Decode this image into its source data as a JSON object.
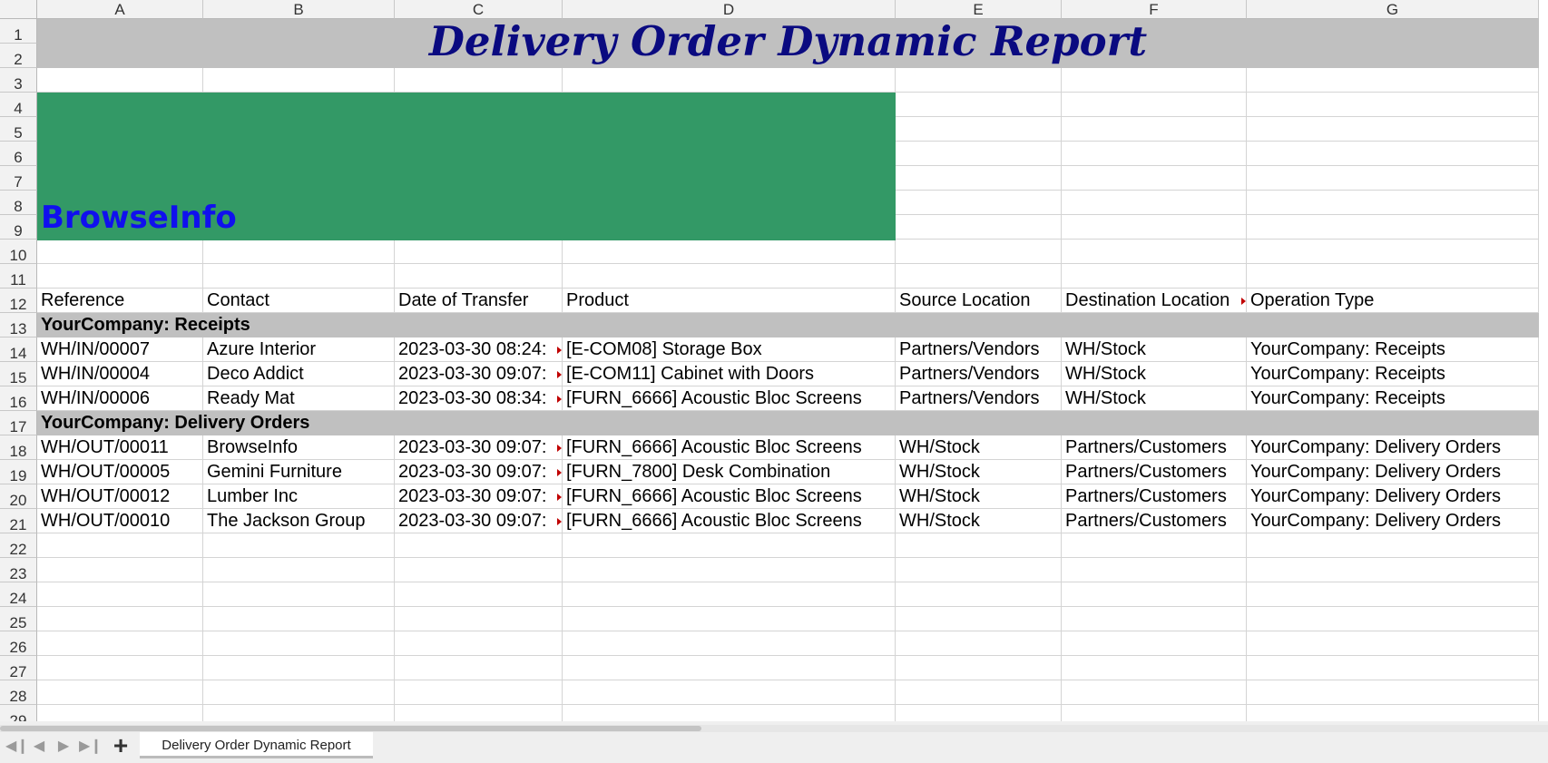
{
  "columns": [
    "A",
    "B",
    "C",
    "D",
    "E",
    "F",
    "G"
  ],
  "rows": [
    "1",
    "2",
    "3",
    "4",
    "5",
    "6",
    "7",
    "8",
    "9",
    "10",
    "11",
    "12",
    "13",
    "14",
    "15",
    "16",
    "17",
    "18",
    "19",
    "20",
    "21",
    "22",
    "23",
    "24",
    "25",
    "26",
    "27",
    "28",
    "29"
  ],
  "title": "Delivery Order Dynamic Report",
  "logo_text": "BrowseInfo",
  "headers": [
    "Reference",
    "Contact",
    "Date of Transfer",
    "Product",
    "Source Location",
    "Destination Location",
    "Operation Type"
  ],
  "groups": [
    {
      "label": "YourCompany: Receipts",
      "records": [
        [
          "WH/IN/00007",
          "Azure Interior",
          "2023-03-30 08:24:",
          "[E-COM08] Storage Box",
          "Partners/Vendors",
          "WH/Stock",
          "YourCompany: Receipts"
        ],
        [
          "WH/IN/00004",
          "Deco Addict",
          "2023-03-30 09:07:",
          "[E-COM11] Cabinet with Doors",
          "Partners/Vendors",
          "WH/Stock",
          "YourCompany: Receipts"
        ],
        [
          "WH/IN/00006",
          "Ready Mat",
          "2023-03-30 08:34:",
          "[FURN_6666] Acoustic Bloc Screens",
          "Partners/Vendors",
          "WH/Stock",
          "YourCompany: Receipts"
        ]
      ]
    },
    {
      "label": "YourCompany: Delivery Orders",
      "records": [
        [
          "WH/OUT/00011",
          "BrowseInfo",
          "2023-03-30 09:07:",
          "[FURN_6666] Acoustic Bloc Screens",
          "WH/Stock",
          "Partners/Customers",
          "YourCompany: Delivery Orders"
        ],
        [
          "WH/OUT/00005",
          "Gemini Furniture",
          "2023-03-30 09:07:",
          "[FURN_7800] Desk Combination",
          "WH/Stock",
          "Partners/Customers",
          "YourCompany: Delivery Orders"
        ],
        [
          "WH/OUT/00012",
          "Lumber Inc",
          "2023-03-30 09:07:",
          "[FURN_6666] Acoustic Bloc Screens",
          "WH/Stock",
          "Partners/Customers",
          "YourCompany: Delivery Orders"
        ],
        [
          "WH/OUT/00010",
          "The Jackson Group",
          "2023-03-30 09:07:",
          "[FURN_6666] Acoustic Bloc Screens",
          "WH/Stock",
          "Partners/Customers",
          "YourCompany: Delivery Orders"
        ]
      ]
    }
  ],
  "sheet_tab": "Delivery Order Dynamic Report",
  "icons": {
    "first_sheet": "first-sheet-icon",
    "prev_sheet": "prev-sheet-icon",
    "next_sheet": "next-sheet-icon",
    "last_sheet": "last-sheet-icon",
    "add_sheet": "add-sheet-icon"
  },
  "colors": {
    "title_band": "#c0c0c0",
    "title_text": "#0a0a80",
    "logo_band": "#339966",
    "logo_text": "#1010ee",
    "group_band": "#c0c0c0"
  }
}
